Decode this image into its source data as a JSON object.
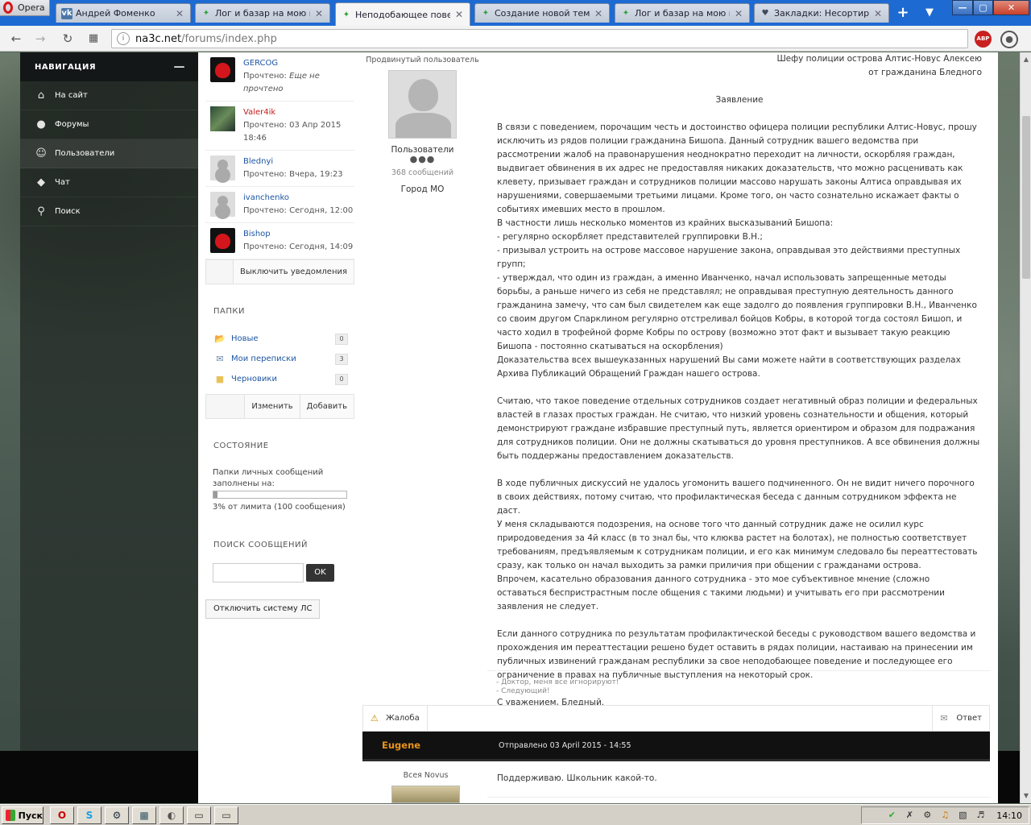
{
  "browser": {
    "app_label": "Opera",
    "tabs": [
      {
        "label": "Андрей Фоменко",
        "icon": "vk-icon"
      },
      {
        "label": "Лог и базар на мою мам",
        "icon": "leaf-icon"
      },
      {
        "label": "Неподобающее поведе",
        "icon": "leaf-icon",
        "active": true
      },
      {
        "label": "Создание новой темы -",
        "icon": "leaf-icon"
      },
      {
        "label": "Лог и базар на мою мам",
        "icon": "leaf-icon"
      },
      {
        "label": "Закладки: Несортирова",
        "icon": "heart-icon"
      }
    ],
    "new_tab_glyph": "+",
    "url_host": "na3c.net",
    "url_path": "/forums/index.php",
    "abp_label": "ABP"
  },
  "sidenav": {
    "title": "НАВИГАЦИЯ",
    "items": [
      {
        "label": "На сайт",
        "icon": "home-icon"
      },
      {
        "label": "Форумы",
        "icon": "chat-bubble-icon"
      },
      {
        "label": "Пользователи",
        "icon": "user-icon"
      },
      {
        "label": "Чат",
        "icon": "tag-icon"
      },
      {
        "label": "Поиск",
        "icon": "search-icon"
      }
    ]
  },
  "participants": [
    {
      "name": "GERCOG",
      "read_label": "Прочтено:",
      "read_value": "Еще не прочтено",
      "avatar": "cobra",
      "name_color": "#1d56a3"
    },
    {
      "name": "Valer4ik",
      "read_label": "Прочтено:",
      "read_value": "03 Апр 2015 18:46",
      "avatar": "photo",
      "name_color": "#c11e1e"
    },
    {
      "name": "Blednyi",
      "read_label": "Прочтено:",
      "read_value": "Вчера, 19:23",
      "avatar": "blank",
      "name_color": "#1d56a3"
    },
    {
      "name": "ivanchenko",
      "read_label": "Прочтено:",
      "read_value": "Сегодня, 12:00",
      "avatar": "blank",
      "name_color": "#1d56a3"
    },
    {
      "name": "Bishop",
      "read_label": "Прочтено:",
      "read_value": "Сегодня, 14:09",
      "avatar": "cobra",
      "name_color": "#1d56a3"
    }
  ],
  "notify_off_label": "Выключить уведомления",
  "folders": {
    "title": "ПАПКИ",
    "items": [
      {
        "name": "Новые",
        "count": "0",
        "icon": "folder-new-icon"
      },
      {
        "name": "Мои переписки",
        "count": "3",
        "icon": "envelope-icon"
      },
      {
        "name": "Черновики",
        "count": "0",
        "icon": "folder-icon"
      }
    ],
    "edit_label": "Изменить",
    "add_label": "Добавить"
  },
  "status": {
    "title": "СОСТОЯНИЕ",
    "text": "Папки личных сообщений заполнены на:",
    "fill_percent": 3,
    "limit_text": "3% от лимита (100 сообщения)"
  },
  "search": {
    "title": "ПОИСК СООБЩЕНИЙ",
    "value": "",
    "ok_label": "OK"
  },
  "disable_pm_label": "Отключить систему ЛС",
  "post": {
    "author_rank": "Продвинутый пользователь",
    "author_group": "Пользователи",
    "author_dots": "●●●",
    "author_posts": "368 сообщений",
    "author_city": "Город МО",
    "address_lines": [
      "Шефу полиции острова Алтис-Новус Алексею",
      "от гражданина Бледного"
    ],
    "title": "Заявление",
    "paragraphs": [
      [
        "В связи с поведением, порочащим честь и достоинство офицера полиции республики Алтис-Новус, прошу исключить из рядов полиции гражданина Бишопа. Данный сотрудник вашего ведомства при рассмотрении жалоб на правонарушения неоднократно переходит на личности, оскорбляя граждан, выдвигает обвинения в их адрес не предоставляя никаких доказательств, что можно расценивать как клевету, призывает граждан и сотрудников полиции массово нарушать законы Алтиса оправдывая их нарушениями, совершаемыми третьими лицами. Кроме того, он часто сознательно искажает факты о событиях имевших место в прошлом.",
        "В частности лишь несколько моментов из крайних высказываний Бишопа:",
        "- регулярно оскорбляет представителей группировки В.Н.;",
        "- призывал устроить на острове массовое нарушение закона, оправдывая это действиями преступных групп;",
        "- утверждал, что один из граждан, а именно Иванченко, начал использовать запрещенные методы борьбы, а раньше ничего из себя не представлял; не оправдывая преступную деятельность данного гражданина замечу, что сам был свидетелем как еще задолго до появления группировки В.Н., Иванченко со своим другом Спарклином регулярно отстреливал бойцов Кобры, в которой тогда состоял Бишоп, и часто ходил в трофейной форме Кобры по острову (возможно этот факт и вызывает такую реакцию Бишопа - постоянно скатываться на оскорбления)",
        "Доказательства всех вышеуказанных нарушений Вы сами можете найти в соответствующих разделах Архива Публикаций Обращений Граждан нашего острова."
      ],
      [
        "Считаю, что такое поведение отдельных сотрудников создает негативный образ полиции и федеральных властей в глазах простых граждан. Не считаю, что низкий уровень сознательности и общения, который демонстрируют граждане избравшие преступный путь, является ориентиром и образом для подражания для сотрудников полиции. Они не должны скатываться до уровня преступников. А все обвинения должны быть поддержаны предоставлением доказательств."
      ],
      [
        "В ходе публичных дискуссий не удалось угомонить вашего подчиненного. Он не видит ничего порочного в своих действиях, потому считаю, что профилактическая беседа с данным сотрудником эффекта не даст.",
        "У меня складываются подозрения, на основе того что данный сотрудник даже не осилил курс природоведения за 4й класс (в то знал бы, что клюква растет на болотах), не полностью соответствует требованиям, предъявляемым к сотрудникам полиции, и его как минимум следовало бы переаттестовать сразу, как только он начал выходить за рамки приличия при общении с гражданами острова.",
        "Впрочем, касательно образования данного сотрудника - это мое субъективное мнение (сложно оставаться беспристрастным после общения с такими людьми) и учитывать его при рассмотрении заявления не следует."
      ],
      [
        "Если данного сотрудника по результатам профилактической беседы с руководством вашего ведомства и прохождения им переаттестации решено будет оставить в рядах полиции, настаиваю на принесении им публичных извинений гражданам республики за свое неподобающее поведение и последующее его ограничение в правах на публичные выступления на некоторый срок."
      ],
      [
        "С уважением, Бледный."
      ]
    ],
    "signature": [
      "- Доктор, меня все игнорируют!",
      "- Следующий!"
    ],
    "report_label": "Жалоба",
    "reply_label": "Ответ"
  },
  "post2": {
    "author": "Eugene",
    "date": "Отправлено 03 April 2015 - 14:55",
    "rank": "Всея Novus",
    "text": "Поддерживаю. Школьник какой-то."
  },
  "taskbar": {
    "start_label": "Пуск",
    "clock": "14:10"
  }
}
